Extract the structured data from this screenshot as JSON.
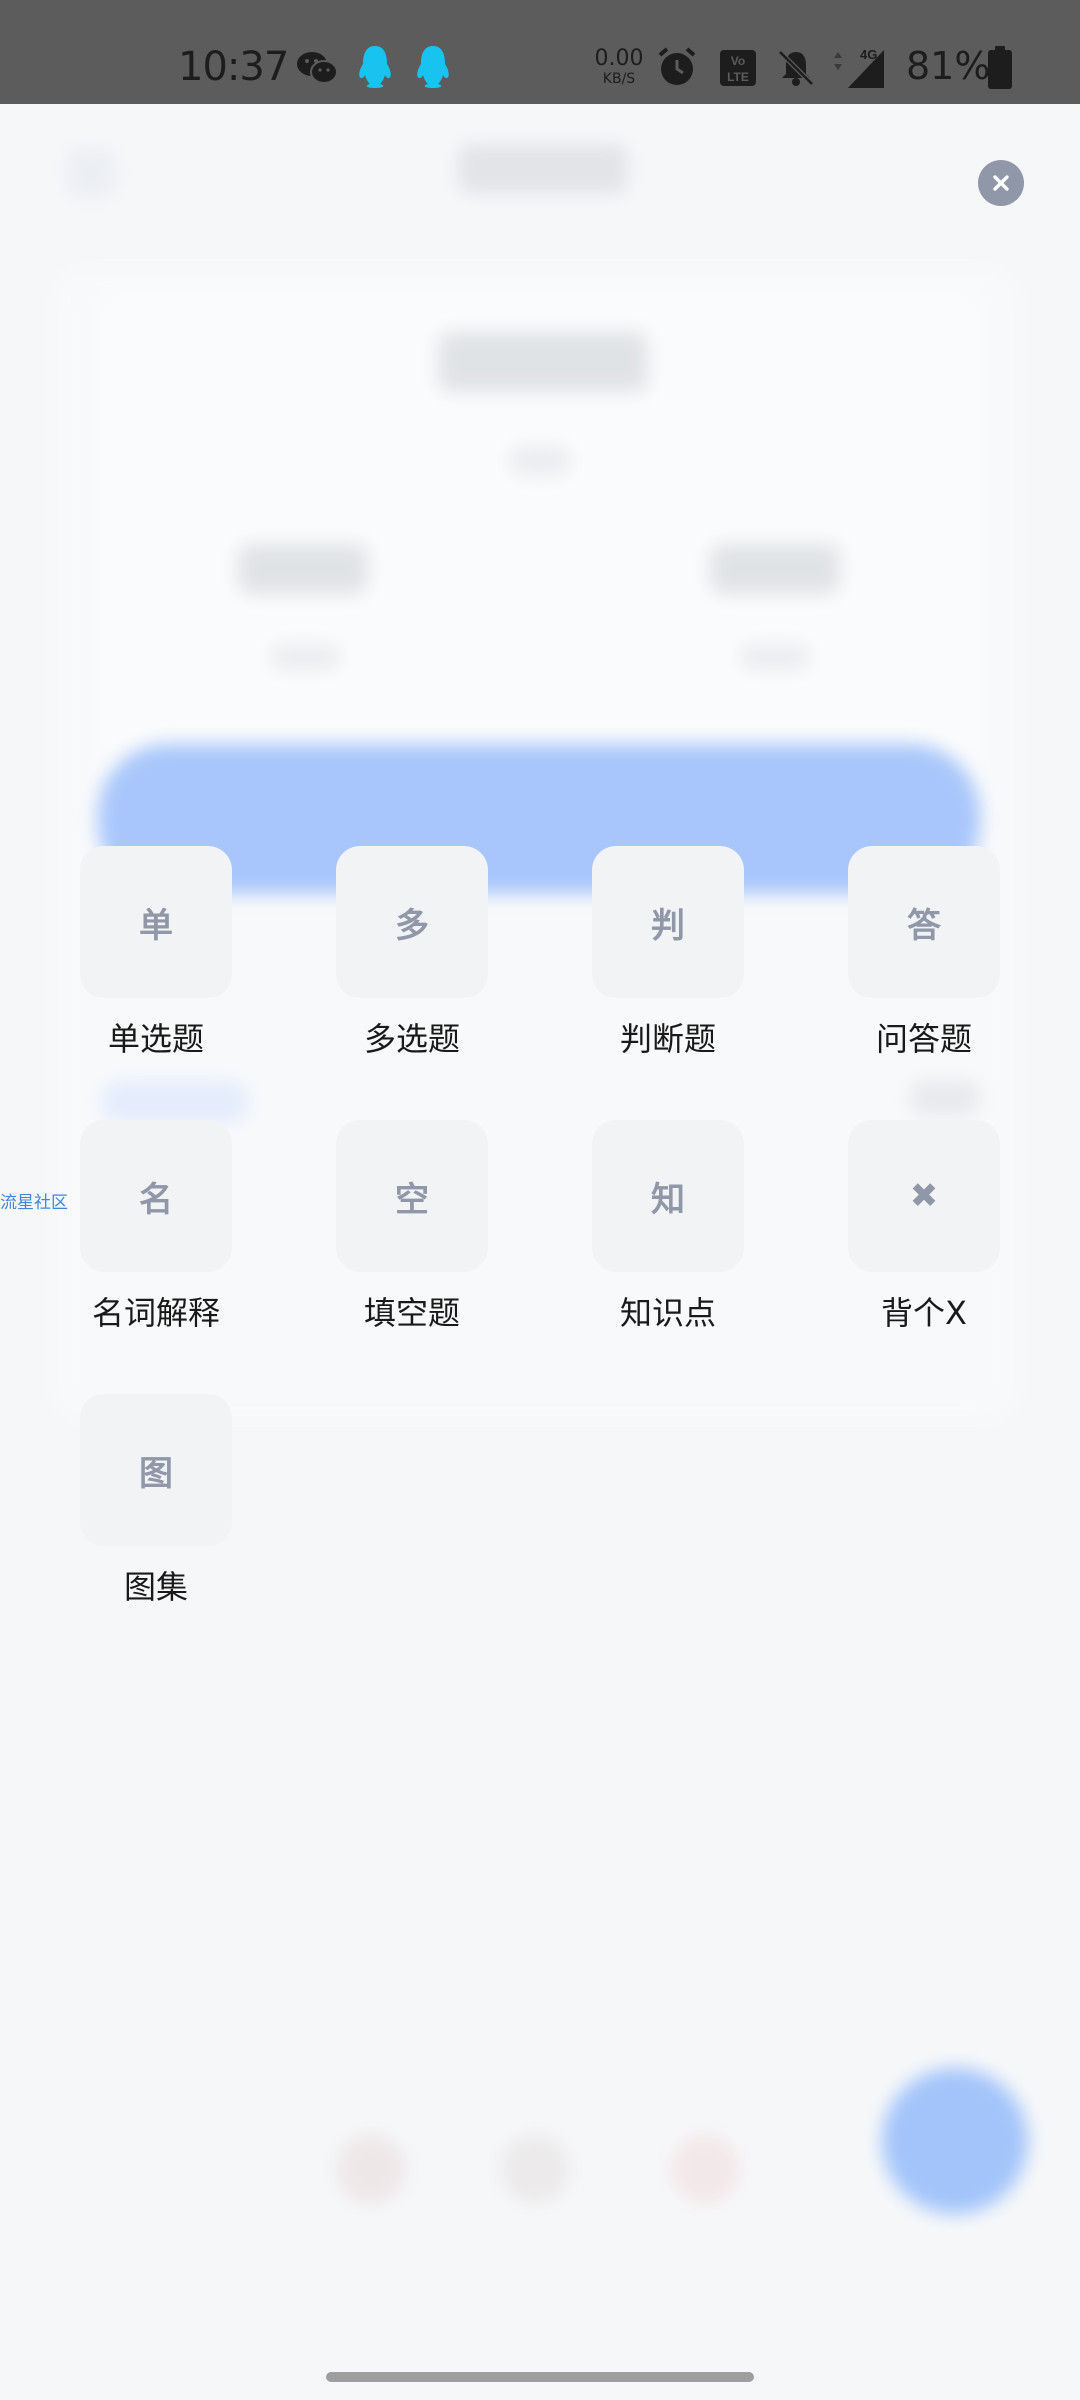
{
  "status_bar": {
    "time": "10:37",
    "net_speed_value": "0.00",
    "net_speed_unit": "KB/S",
    "battery_percent": "81%",
    "icons": [
      "wechat-icon",
      "qq-icon",
      "qq-icon",
      "alarm-icon",
      "volte-icon",
      "bell-off-icon",
      "signal-4g-icon",
      "battery-icon"
    ]
  },
  "colors": {
    "tile_bg": "#f2f3f5",
    "tile_glyph": "#8f97a8",
    "primary_blue": "#4a8bfc",
    "close_button": "#8f97a8",
    "link_blue": "#3f86e0"
  },
  "menu": {
    "close_icon": "close-icon",
    "items": [
      {
        "glyph": "单",
        "label": "单选题"
      },
      {
        "glyph": "多",
        "label": "多选题"
      },
      {
        "glyph": "判",
        "label": "判断题"
      },
      {
        "glyph": "答",
        "label": "问答题"
      },
      {
        "glyph": "名",
        "label": "名词解释"
      },
      {
        "glyph": "空",
        "label": "填空题"
      },
      {
        "glyph": "知",
        "label": "知识点"
      },
      {
        "glyph": "✖",
        "label": "背个X"
      },
      {
        "glyph": "图",
        "label": "图集"
      }
    ]
  },
  "side_link": "流星社区"
}
